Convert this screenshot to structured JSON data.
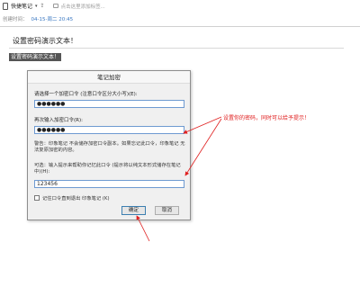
{
  "toolbar": {
    "notebook_label": "快捷笔记",
    "tag_hint": "点击这里添加标签..."
  },
  "meta": {
    "created_label": "创建时间：",
    "created_date": "04-15-周二 20:45"
  },
  "note": {
    "title": "设置密码演示文本！",
    "selected_text": "设置密码演示文本！"
  },
  "dialog": {
    "title": "笔记加密",
    "password_label": "请选择一个加密口令 (注意口令区分大小写)(E):",
    "password_value": "●●●●●●",
    "confirm_label": "再次输入加密口令(R):",
    "confirm_value": "●●●●●●",
    "warning": "警告：印象笔记 不会储存加密口令副本。如果忘记此口令，印象笔记 无法复原加密的内容。",
    "hint_label": "可选：输入提示来帮助你记忆此口令 (提示将以纯文本形式储存在笔记中)(H):",
    "hint_value": "123456",
    "remember_label": "记住口令直到退出 印象笔记 (K)",
    "ok_label": "确定",
    "cancel_label": "取消"
  },
  "annotation": {
    "text": "设置你的密码，同时可以给予提示！",
    "color": "#e02020"
  }
}
